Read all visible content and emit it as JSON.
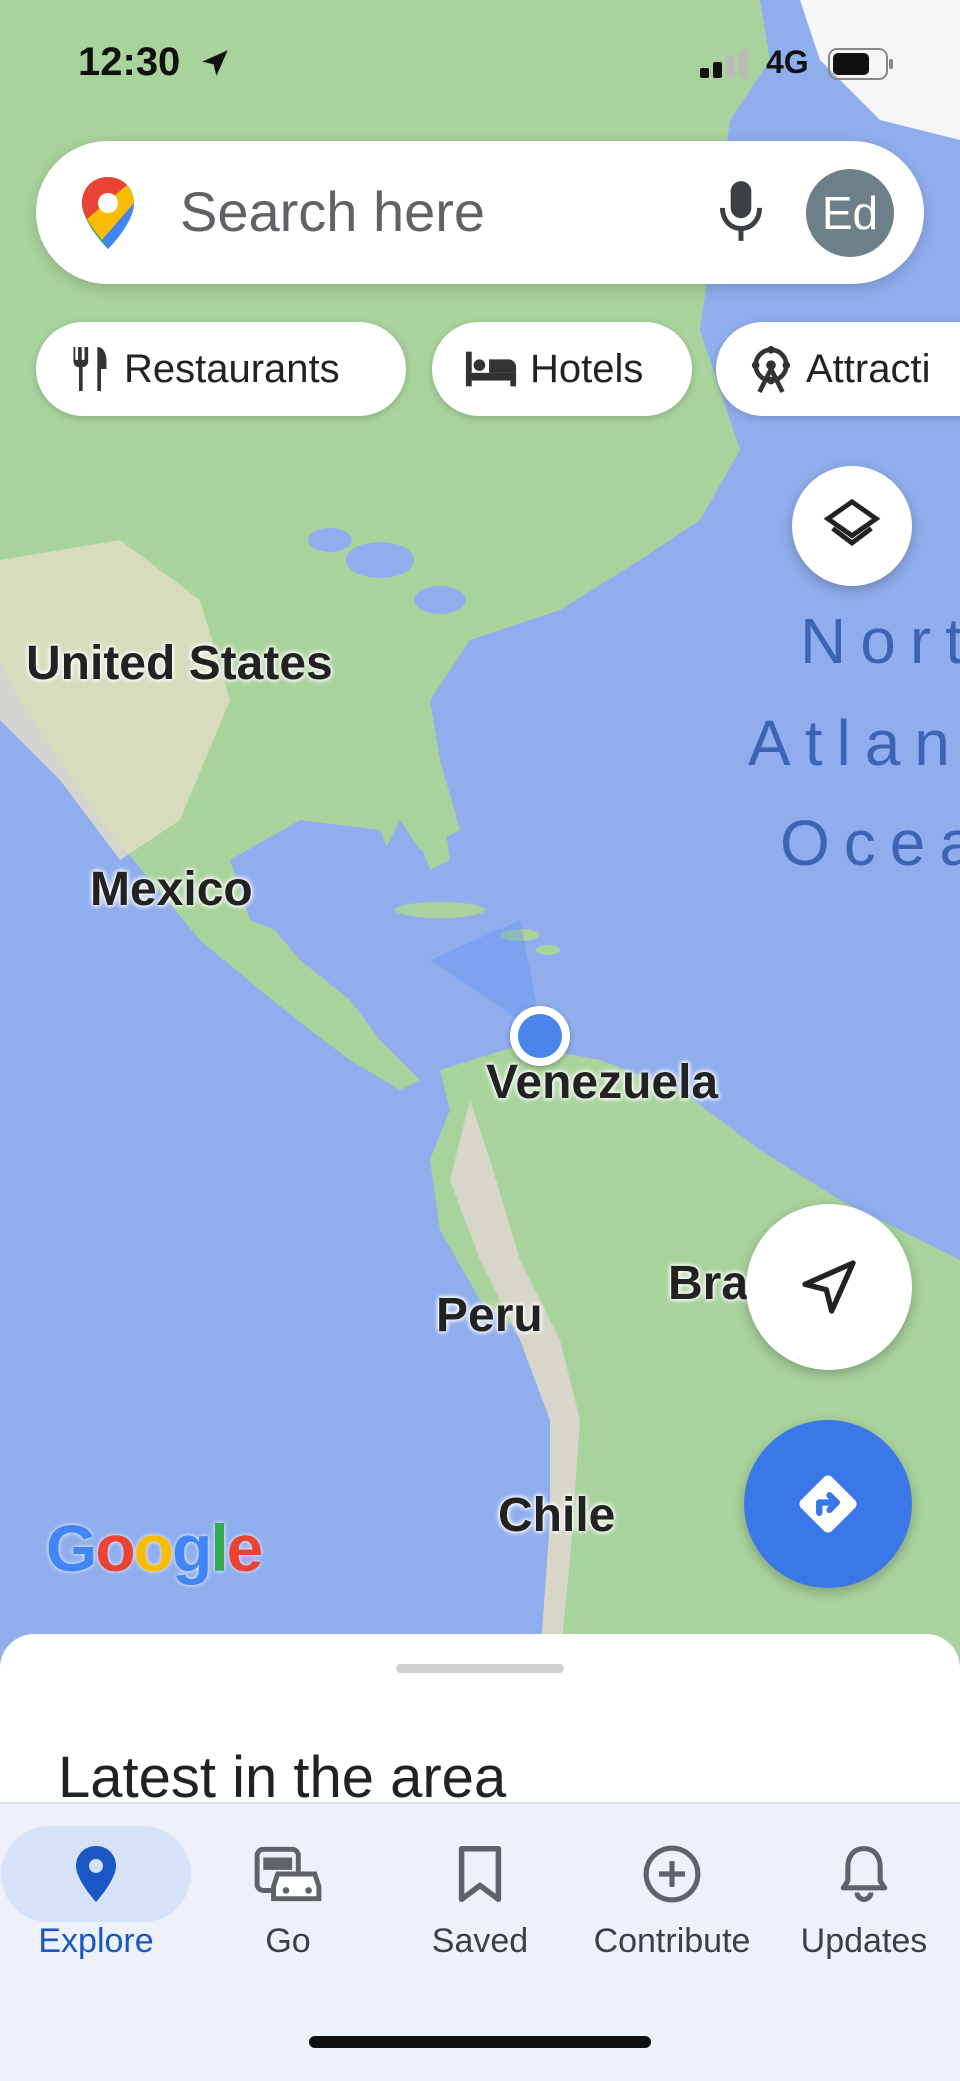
{
  "status_bar": {
    "time": "12:30",
    "network": "4G"
  },
  "search": {
    "placeholder": "Search here",
    "avatar_initials": "Ed"
  },
  "chips": [
    {
      "label": "Restaurants",
      "icon": "fork-knife-icon"
    },
    {
      "label": "Hotels",
      "icon": "bed-icon"
    },
    {
      "label": "Attracti",
      "icon": "ferris-wheel-icon"
    }
  ],
  "map": {
    "countries": [
      "United States",
      "Mexico",
      "Venezuela",
      "Peru",
      "Bra",
      "Chile"
    ],
    "ocean_lines": [
      "Nort",
      "Atlan",
      "Ocea"
    ],
    "attribution": "Google"
  },
  "sheet": {
    "title": "Latest in the area"
  },
  "bottom_nav": [
    {
      "label": "Explore",
      "icon": "location-pin-icon",
      "active": true
    },
    {
      "label": "Go",
      "icon": "commute-icon",
      "active": false
    },
    {
      "label": "Saved",
      "icon": "bookmark-icon",
      "active": false
    },
    {
      "label": "Contribute",
      "icon": "add-circle-icon",
      "active": false
    },
    {
      "label": "Updates",
      "icon": "bell-icon",
      "active": false
    }
  ],
  "colors": {
    "accent": "#3b78e7",
    "ocean": "#90aeee",
    "land": "#a9d39d",
    "active_pill": "#d6e2f8"
  }
}
